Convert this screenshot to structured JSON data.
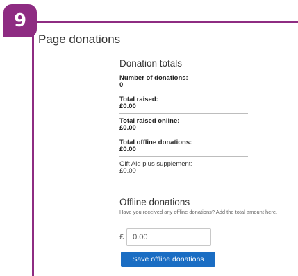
{
  "step_badge": "9",
  "page_title": "Page donations",
  "totals": {
    "title": "Donation totals",
    "items": [
      {
        "label": "Number of donations:",
        "value": "0"
      },
      {
        "label": "Total raised:",
        "value": "£0.00"
      },
      {
        "label": "Total raised online:",
        "value": "£0.00"
      },
      {
        "label": "Total offline donations:",
        "value": "£0.00"
      },
      {
        "label": "Gift Aid plus supplement:",
        "value": "£0.00"
      }
    ]
  },
  "offline": {
    "title": "Offline donations",
    "hint": "Have you received any offline donations? Add the total amount here.",
    "currency": "£",
    "amount_value": "0.00",
    "save_label": "Save offline donations"
  },
  "colors": {
    "frame": "#8e2c82",
    "button": "#1a6dc3"
  }
}
